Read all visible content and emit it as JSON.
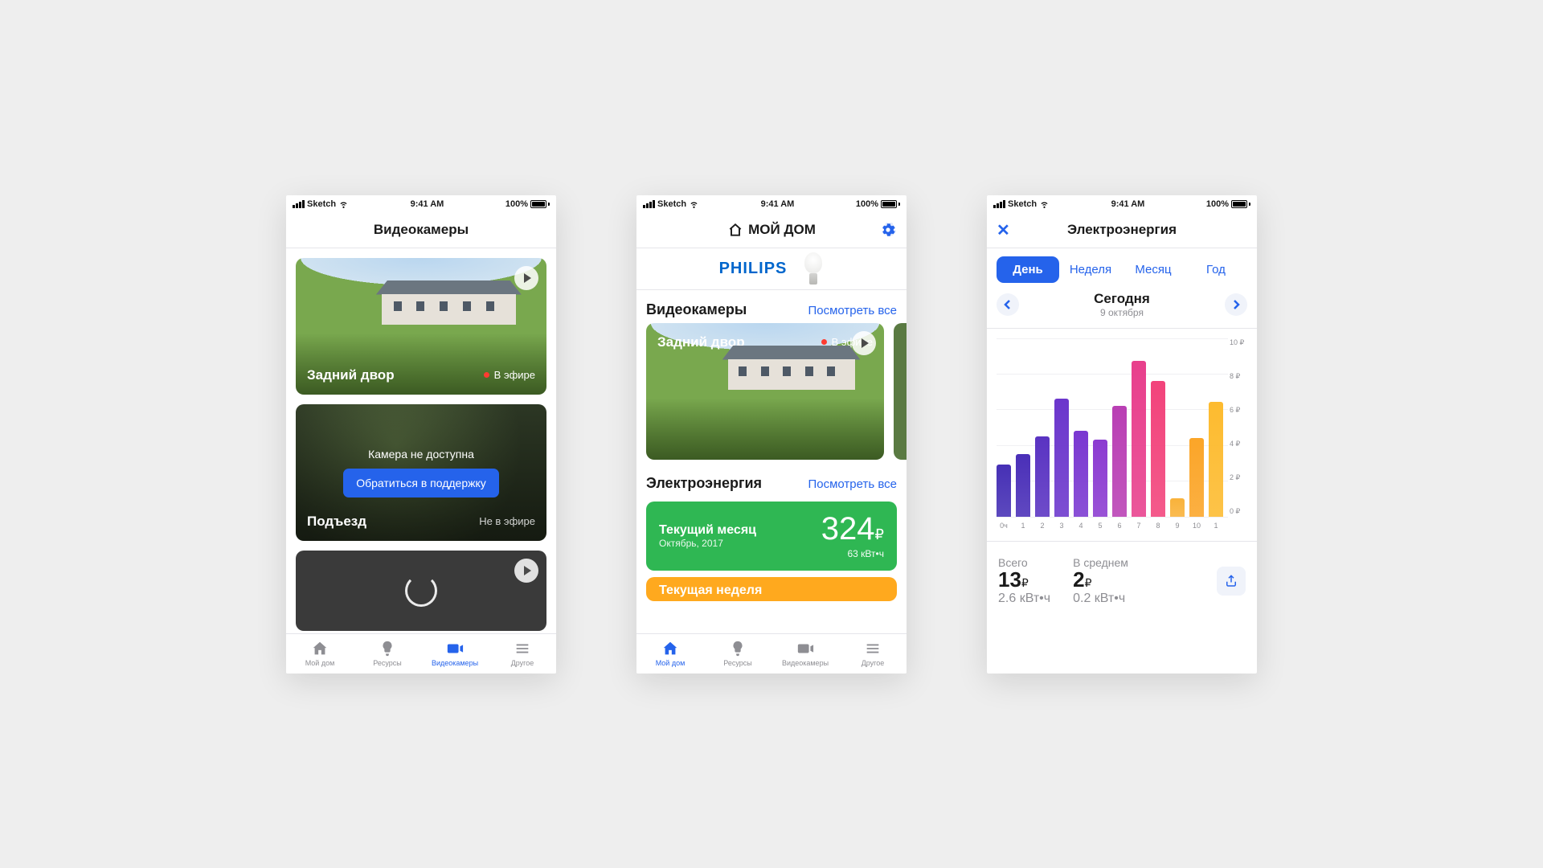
{
  "status": {
    "carrier": "Sketch",
    "time": "9:41 AM",
    "battery": "100%"
  },
  "tabs": {
    "home": "Мой дом",
    "resources": "Ресурсы",
    "cameras": "Видеокамеры",
    "other": "Другое"
  },
  "screen1": {
    "title": "Видеокамеры",
    "cam1": {
      "name": "Задний двор",
      "status": "В эфире"
    },
    "cam2": {
      "name": "Подъезд",
      "status": "Не в эфире",
      "unavail": "Камера не доступна",
      "support_btn": "Обратиться в поддержку"
    }
  },
  "screen2": {
    "title": "МОЙ ДОМ",
    "promo_brand": "PHILIPS",
    "cameras_title": "Видеокамеры",
    "see_all": "Посмотреть все",
    "cam": {
      "name": "Задний двор",
      "status": "В эфире"
    },
    "energy_title": "Электроэнергия",
    "month_card": {
      "l1": "Текущий месяц",
      "l2": "Октябрь, 2017",
      "val": "324",
      "cur": "₽",
      "sub": "63 кВт•ч"
    },
    "week_card": {
      "l1": "Текущая неделя"
    }
  },
  "screen3": {
    "title": "Электроэнергия",
    "segments": {
      "day": "День",
      "week": "Неделя",
      "month": "Месяц",
      "year": "Год"
    },
    "date": {
      "label": "Сегодня",
      "sub": "9 октября"
    },
    "yticks": [
      "10 ₽",
      "8 ₽",
      "6 ₽",
      "4 ₽",
      "2 ₽",
      "0 ₽"
    ],
    "xticks": [
      "0ч",
      "1",
      "2",
      "3",
      "4",
      "5",
      "6",
      "7",
      "8",
      "9",
      "10",
      "1"
    ],
    "totals": {
      "total_label": "Всего",
      "total_val": "13",
      "total_cur": "₽",
      "total_sub": "2.6 кВт•ч",
      "avg_label": "В среднем",
      "avg_val": "2",
      "avg_cur": "₽",
      "avg_sub": "0.2 кВт•ч"
    }
  },
  "chart_data": {
    "type": "bar",
    "categories": [
      "0",
      "1",
      "2",
      "3",
      "4",
      "5",
      "6",
      "7",
      "8",
      "9",
      "10",
      "11"
    ],
    "values": [
      2.9,
      3.5,
      4.5,
      6.6,
      4.8,
      4.3,
      6.2,
      8.7,
      7.6,
      1.0,
      4.4,
      6.4
    ],
    "xlabel": "ч",
    "ylabel": "₽",
    "ylim": [
      0,
      10
    ],
    "color_scheme": "spectral_purple_to_yellow"
  }
}
